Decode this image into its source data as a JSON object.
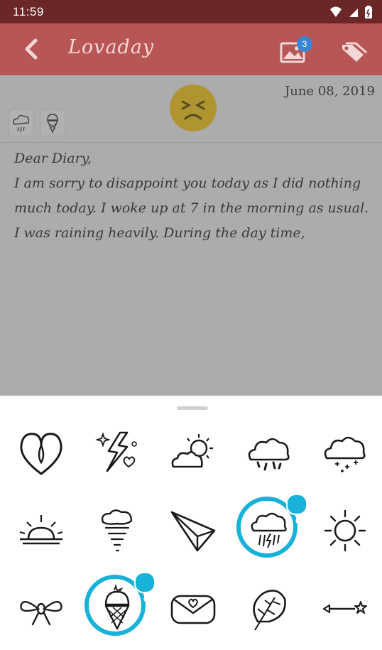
{
  "status_bar": {
    "time": "11:59",
    "icons": [
      "wifi-icon",
      "signal-icon",
      "battery-icon"
    ]
  },
  "app_bar": {
    "title": "Lovaday",
    "photo_badge": "3",
    "icons": [
      "back-icon",
      "photo-icon",
      "tag-icon"
    ]
  },
  "entry": {
    "date": "June 08, 2019",
    "mood": "sad-face",
    "stickers": [
      "rain-cloud",
      "ice-cream"
    ],
    "text": "Dear Diary,\nI am sorry to disappoint you today as I did nothing much today. I woke up at 7 in the morning as usual. I was raining heavily. During the day time,"
  },
  "sticker_picker": {
    "items": [
      {
        "icon": "heart-icon",
        "selected": false
      },
      {
        "icon": "lightning-heart-icon",
        "selected": false
      },
      {
        "icon": "sun-cloud-icon",
        "selected": false
      },
      {
        "icon": "rain-cloud-icon",
        "selected": false
      },
      {
        "icon": "snow-cloud-icon",
        "selected": false
      },
      {
        "icon": "sunrise-icon",
        "selected": false
      },
      {
        "icon": "tornado-icon",
        "selected": false
      },
      {
        "icon": "paper-plane-icon",
        "selected": false
      },
      {
        "icon": "storm-cloud-icon",
        "selected": true
      },
      {
        "icon": "sun-icon",
        "selected": false
      },
      {
        "icon": "bow-icon",
        "selected": false
      },
      {
        "icon": "ice-cream-icon",
        "selected": true
      },
      {
        "icon": "love-letter-icon",
        "selected": false
      },
      {
        "icon": "leaf-icon",
        "selected": false
      },
      {
        "icon": "arrow-icon",
        "selected": false
      }
    ],
    "accent": "#18b2d8"
  }
}
